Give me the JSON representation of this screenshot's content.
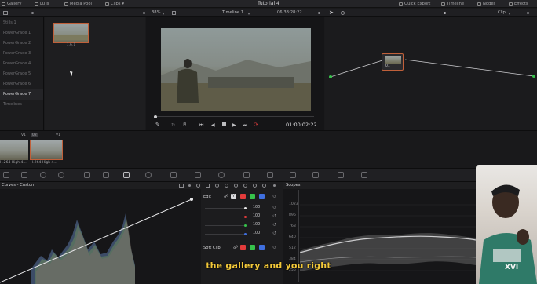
{
  "top_bar": {
    "gallery": "Gallery",
    "luts": "LUTs",
    "media_pool": "Media Pool",
    "clips": "Clips",
    "project_title": "Tutorial 4",
    "quick_export": "Quick Export",
    "timeline": "Timeline",
    "nodes": "Nodes",
    "effects": "Effects"
  },
  "sub_bar": {
    "zoom": "38%",
    "timeline_name": "Timeline 1",
    "timecode": "06:38:28:22",
    "node_mode": "Clip"
  },
  "albums": [
    "Stills 1",
    "PowerGrade 1",
    "PowerGrade 2",
    "PowerGrade 3",
    "PowerGrade 4",
    "PowerGrade 5",
    "PowerGrade 6",
    "PowerGrade 7",
    "Timelines"
  ],
  "selected_album": "PowerGrade 7",
  "still_label": "1.6.1",
  "viewer": {
    "timecode": "01:00:02:22"
  },
  "node": {
    "label": "01"
  },
  "clips": [
    {
      "index": "01",
      "track": "V1",
      "name": "H.264 High 4..."
    },
    {
      "index": "02",
      "track": "V1",
      "name": "H.264 High 4..."
    }
  ],
  "curves": {
    "title": "Curves - Custom"
  },
  "edit": {
    "label": "Edit",
    "soft_clip": "Soft Clip",
    "y_chip": "Y",
    "rows": [
      {
        "channel": "white",
        "color": "#e8e8e8",
        "value": "100"
      },
      {
        "channel": "red",
        "color": "#e33b3b",
        "value": "100"
      },
      {
        "channel": "green",
        "color": "#36c24b",
        "value": "100"
      },
      {
        "channel": "blue",
        "color": "#3f6fe0",
        "value": "100"
      }
    ]
  },
  "scopes": {
    "title": "Scopes",
    "scale": [
      "1023",
      "896",
      "768",
      "640",
      "512",
      "384",
      "256"
    ]
  },
  "subtitle": "the gallery and you right",
  "webcam_watermark": "XVI",
  "colors": {
    "accent": "#c0603a",
    "subtitle": "#f2c83a",
    "timecode_red": "#d23b3b"
  }
}
